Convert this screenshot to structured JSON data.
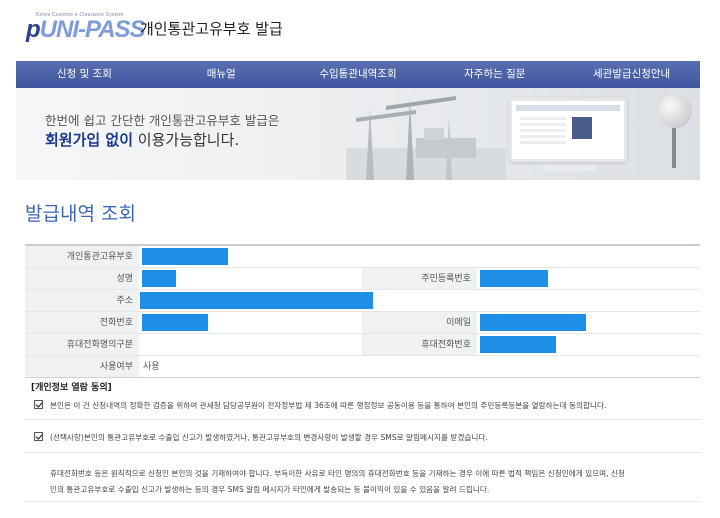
{
  "header": {
    "logo_tagline": "Korea Customs e-Clearance System",
    "logo_brand_main": "UNI-PASS",
    "logo_brand_prefix": "p",
    "title": "개인통관고유부호 발급"
  },
  "nav": {
    "items": [
      {
        "label": "신청 및 조회"
      },
      {
        "label": "매뉴얼"
      },
      {
        "label": "수입통관내역조회"
      },
      {
        "label": "자주하는 질문"
      },
      {
        "label": "세관발급신청안내"
      }
    ]
  },
  "banner": {
    "line1": "한번에 쉽고 간단한 개인통관고유부호 발급은",
    "line2_em": "회원가입 없이",
    "line2_rest": " 이용가능합니다."
  },
  "section_title": "발급내역 조회",
  "info": {
    "rows": [
      {
        "label": "개인통관고유부호"
      },
      {
        "label_left": "성명",
        "label_right": "주민등록번호"
      },
      {
        "label": "주소"
      },
      {
        "label_left": "전화번호",
        "label_right": "이메일"
      },
      {
        "label_left": "휴대전화명의구분",
        "label_right": "휴대전화번호"
      },
      {
        "label": "사용여부",
        "value": "사용"
      }
    ]
  },
  "consent": {
    "heading": "[개인정보 열람 동의]",
    "item1": "본인은 이 건 신청내역의 정확한 검증을 위하여 관세청 담당공무원이 전자정부법 제 36조에 따른 행정정보 공동이용 등을 통하여 본인의 주민등록등본을 열람하는데 동의합니다.",
    "item2": "(선택사항)본인의 통관고유부호로 수출입 신고가 발생하였거나, 통관고유부호의 변경사항이 발생할 경우 SMS로 알림메시지를 받겠습니다.",
    "notice_line1": "휴대전화번호 등은 원칙적으로 신청인 본인의 것을 기재하여야 합니다. 부득이한 사유로 타인 명의의 휴대전화번호 등을 기재하는 경우 이에 따른 법적 책임은 신청인에게 있으며, 신청",
    "notice_line2": "인의 통관고유부호로 수출입 신고가 발생하는 등의 경우 SMS 알림 메시지가 타인에게 발송되는 등 불이익이 있을 수 있음을 알려 드립니다.",
    "item1_checked": true,
    "item2_checked": true
  },
  "colors": {
    "nav": "#4a60a8",
    "title_blue": "#3a67b8",
    "mask_blue": "#1e8fe6"
  }
}
